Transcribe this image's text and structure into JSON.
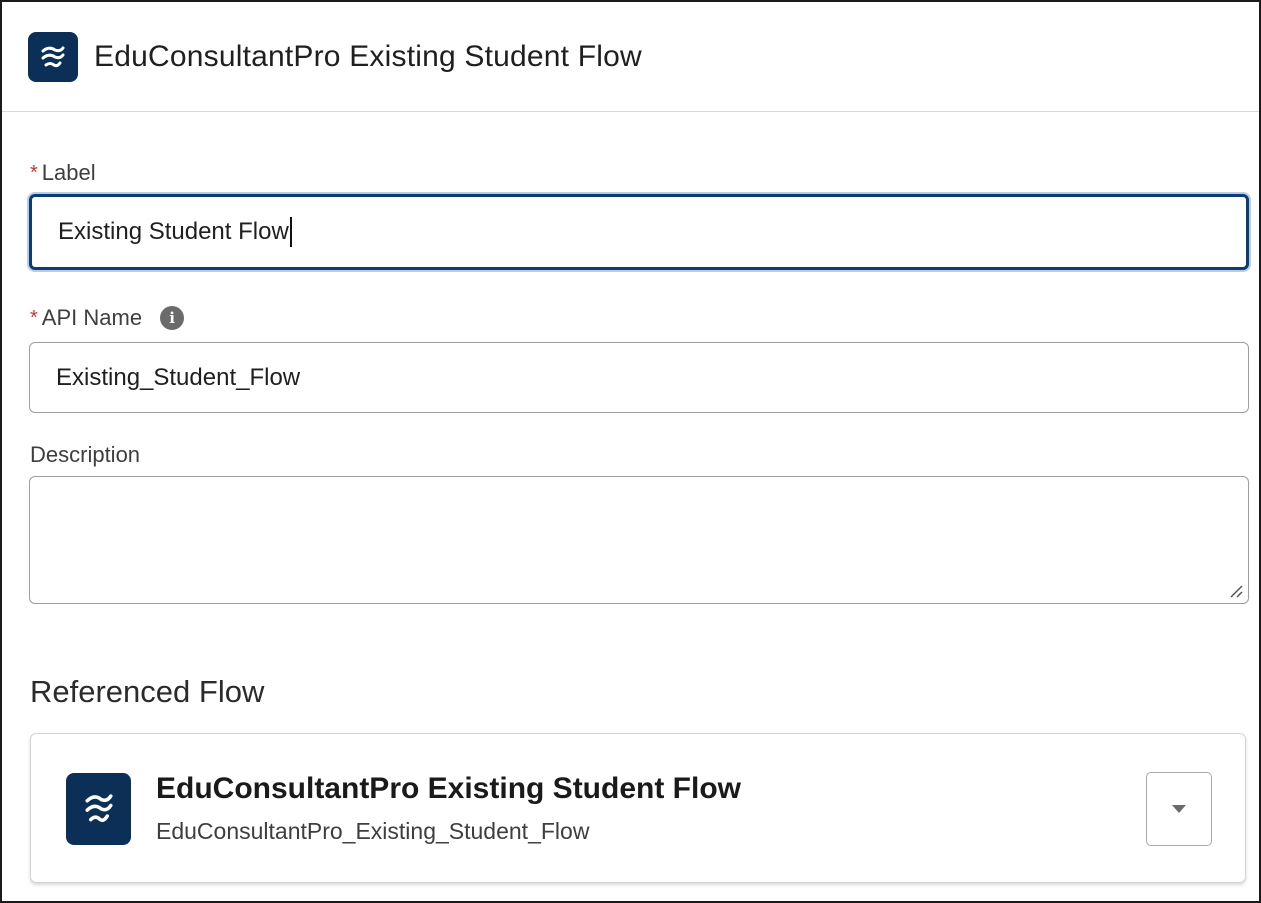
{
  "header": {
    "icon": "flow-icon",
    "title": "EduConsultantPro Existing Student Flow"
  },
  "form": {
    "label": {
      "label": "Label",
      "required_marker": "*",
      "value": "Existing Student Flow"
    },
    "api_name": {
      "label": "API Name",
      "required_marker": "*",
      "info_icon": "info-icon",
      "value": "Existing_Student_Flow"
    },
    "description": {
      "label": "Description",
      "value": ""
    }
  },
  "referenced_flow": {
    "section_title": "Referenced Flow",
    "icon": "flow-icon",
    "name": "EduConsultantPro Existing Student Flow",
    "api_name": "EduConsultantPro_Existing_Student_Flow",
    "dropdown_icon": "caret-down-icon"
  },
  "colors": {
    "brand_badge": "#0c2f57",
    "focus_border": "#0b3d73",
    "required": "#c23934"
  }
}
